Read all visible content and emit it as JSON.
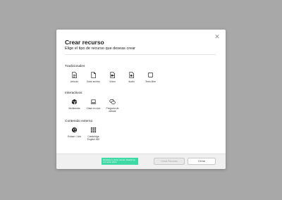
{
  "dialog": {
    "title": "Crear recurso",
    "subtitle": "Elige el tipo de recurso que deseas crear",
    "close_icon": "✕"
  },
  "sections": {
    "traditional": {
      "label": "Tradicionales",
      "items": [
        {
          "label": "Artículo",
          "icon": "article-icon"
        },
        {
          "label": "Subir archivo",
          "icon": "upload-file-icon"
        },
        {
          "label": "Vídeo",
          "icon": "video-icon"
        },
        {
          "label": "Audio",
          "icon": "audio-icon"
        },
        {
          "label": "Texto libre",
          "icon": "free-text-icon"
        }
      ]
    },
    "interactive": {
      "label": "Interactivos",
      "items": [
        {
          "label": "Multimedia",
          "icon": "multimedia-icon"
        },
        {
          "label": "Clase en vivo",
          "icon": "live-class-icon"
        },
        {
          "label": "Pregunta de debate",
          "icon": "debate-question-icon"
        }
      ]
    },
    "external": {
      "label": "Contenido externo",
      "items": [
        {
          "label": "Enlace / Link",
          "icon": "link-icon"
        },
        {
          "label": "Cambridge English 360",
          "icon": "apps-grid-icon"
        }
      ]
    }
  },
  "footer": {
    "notice": "Escribiste tu primer recurso. Diseña hoy uno nuevo ahora",
    "create_label": "Crear Recurso",
    "cancel_label": "Cerrar"
  },
  "colors": {
    "overlay": "#a8a8a8",
    "notice_bg": "#3fd9a6",
    "footer_bg": "#f0f0f0"
  }
}
